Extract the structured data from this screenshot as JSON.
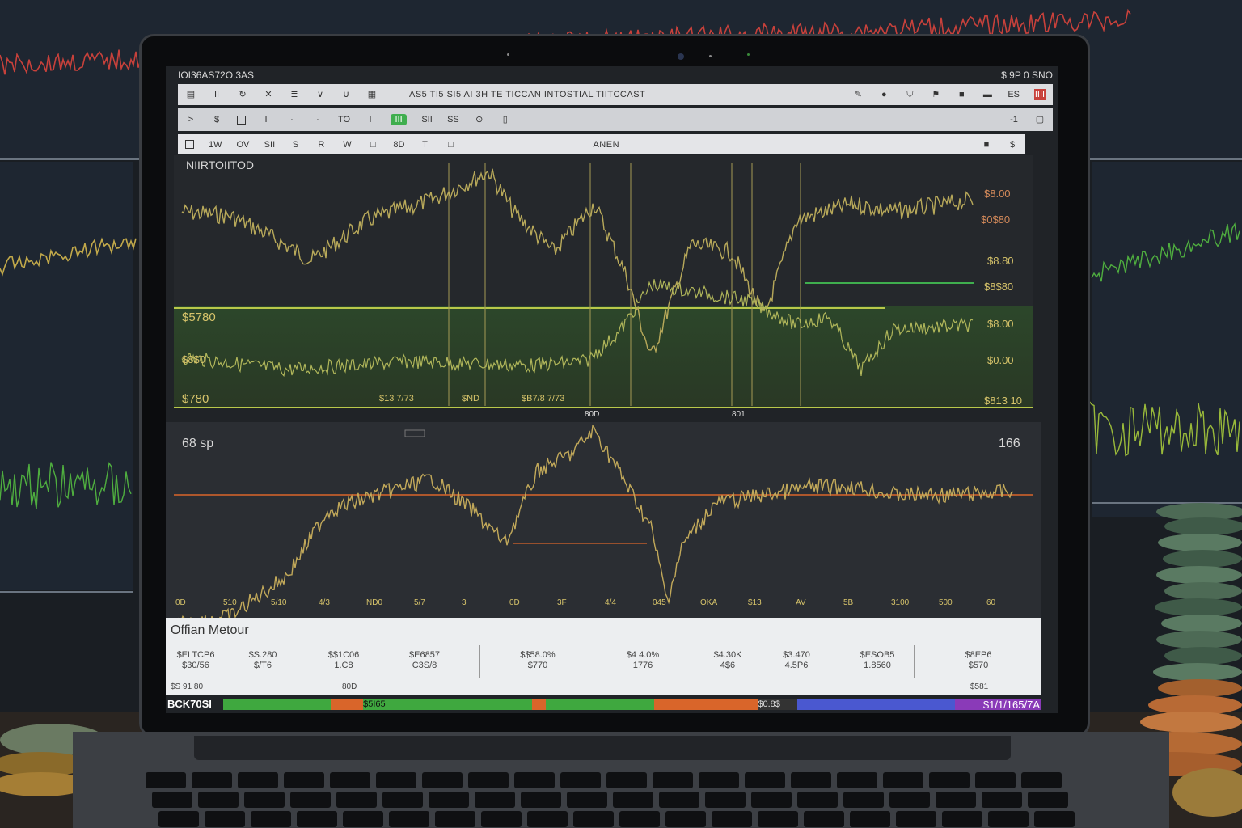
{
  "window": {
    "top_left": "IOI36AS72O.3AS",
    "top_right": "$ 9P 0 SNO"
  },
  "toolbar1": {
    "icons": [
      "menu-icon",
      "pause-icon",
      "refresh-icon",
      "cross-icon",
      "list-icon",
      "down-icon",
      "undo-icon",
      "grid-icon"
    ],
    "title": "AS5 TI5  SI5    AI   3H   TE   TICCAN INTOSTIAL TIITCCAST",
    "right_icons": [
      "pencil-icon",
      "circle-icon",
      "shield-icon",
      "flag-icon",
      "square-icon",
      "bag-icon"
    ],
    "right_label": "ES",
    "close_label": "IIII"
  },
  "toolbar2": {
    "items": [
      ">",
      "$",
      "□",
      "I",
      "·",
      "·",
      "TO",
      "I"
    ],
    "green_label": "III",
    "icon_b": "SII",
    "icon_c": "SS",
    "right_label": "-1"
  },
  "toolbar3": {
    "items": [
      "1W",
      "OV",
      "SII",
      "S",
      "R",
      "W",
      "□",
      "8D",
      "T",
      "□"
    ],
    "center": "ANEN",
    "right_items": [
      "■",
      "$"
    ]
  },
  "chart_top": {
    "label": "NIIRTOIITOD",
    "left_prices": [
      "$5780",
      "$8$0",
      "$780"
    ],
    "right_prices": [
      "$8.00",
      "$0$80",
      "$8.80",
      "$8$80",
      "$8.00",
      "$0.00",
      "$813 10"
    ],
    "x_labels": [
      "$13 7/73",
      "$ND",
      "$B7/8 7/73"
    ],
    "center_marks": [
      "80D",
      "801"
    ]
  },
  "chart_bottom": {
    "left_label": "68 sp",
    "right_label": "166",
    "x_ticks": [
      "0D",
      "510",
      "5/10",
      "4/3",
      "ND0",
      "5/7",
      "3",
      "0D",
      "3F",
      "4/4",
      "045",
      "OKA",
      "$13",
      "AV",
      "5B",
      "3100",
      "500",
      "60"
    ]
  },
  "bottom_panel": {
    "title": "Offian Metour",
    "cells": [
      {
        "a": "$ELTCP6",
        "b": "$30/56"
      },
      {
        "a": "$S.280",
        "b": "$/T6"
      },
      {
        "a": "$$1C06",
        "b": "1.C8"
      },
      {
        "a": "$E6857",
        "b": "C3S/8"
      },
      {
        "a": "$$58.0%",
        "b": "$770"
      },
      {
        "a": "$4 4.0%",
        "b": "1776"
      },
      {
        "a": "$4.30K",
        "b": "4$6"
      },
      {
        "a": "$3.470",
        "b": "4.5P6"
      },
      {
        "a": "$ESOB5",
        "b": "1.8560"
      },
      {
        "a": "$8EP6",
        "b": "$570"
      }
    ],
    "footer_left": "$S 91 80",
    "footer_mid": "80D",
    "footer_right": "$581"
  },
  "status_bar": {
    "left": "BCK70SI",
    "seg_label1": "$5I65",
    "seg_label2": "$0.8$",
    "right": "$1/1/165/7A",
    "colors": [
      "#3fa83f",
      "#d9652a",
      "#3fa83f",
      "#d9652a",
      "#3fa83f",
      "#d9652a",
      "#3a7d8a",
      "#4a58d0",
      "#8a3ab8"
    ]
  }
}
